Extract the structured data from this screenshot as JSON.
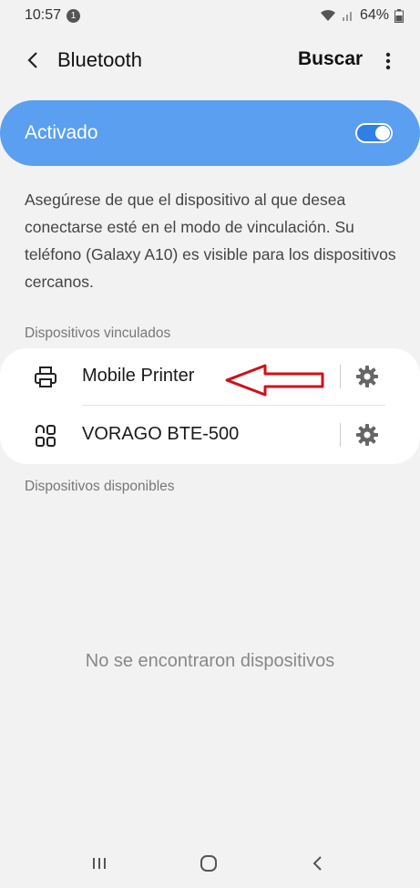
{
  "status_bar": {
    "time": "10:57",
    "notification_count": "1",
    "battery": "64%"
  },
  "header": {
    "title": "Bluetooth",
    "scan_label": "Buscar"
  },
  "toggle": {
    "label": "Activado",
    "on": true,
    "card_color": "#5a9ff0"
  },
  "info": {
    "text": "Asegúrese de que el dispositivo al que desea conectarse esté en el modo de vinculación. Su teléfono (Galaxy A10) es visible para los dispositivos cercanos."
  },
  "paired": {
    "section_label": "Dispositivos vinculados",
    "devices": [
      {
        "name": "Mobile Printer",
        "icon": "printer-icon"
      },
      {
        "name": "VORAGO BTE-500",
        "icon": "device-grid-icon"
      }
    ]
  },
  "available": {
    "section_label": "Dispositivos disponibles",
    "empty_text": "No se encontraron dispositivos"
  },
  "annotation": {
    "arrow_color": "#d0101a"
  }
}
